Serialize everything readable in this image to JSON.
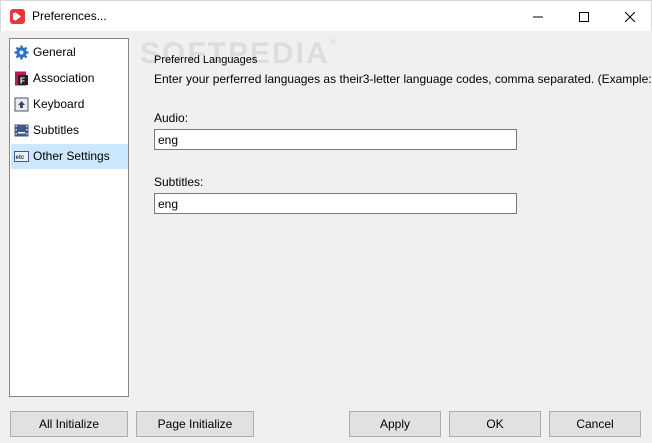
{
  "window": {
    "title": "Preferences...",
    "app_icon": "app-logo-icon",
    "controls": {
      "minimize": "minimize-icon",
      "maximize": "maximize-icon",
      "close": "close-icon"
    }
  },
  "watermark": {
    "text": "SOFTPEDIA",
    "mark": "®"
  },
  "sidebar": {
    "items": [
      {
        "label": "General",
        "icon": "gear-icon"
      },
      {
        "label": "Association",
        "icon": "file-association-icon"
      },
      {
        "label": "Keyboard",
        "icon": "keyboard-icon"
      },
      {
        "label": "Subtitles",
        "icon": "subtitles-icon"
      },
      {
        "label": "Other Settings",
        "icon": "etc-icon",
        "selected": true
      }
    ]
  },
  "content": {
    "section_title": "Preferred Languages",
    "description": "Enter your perferred languages as their3-letter language codes, comma separated. (Example: \"eng,g",
    "audio": {
      "label": "Audio:",
      "value": "eng"
    },
    "subtitles": {
      "label": "Subtitles:",
      "value": "eng"
    }
  },
  "buttons": {
    "all_initialize": "All Initialize",
    "page_initialize": "Page Initialize",
    "apply": "Apply",
    "ok": "OK",
    "cancel": "Cancel"
  },
  "colors": {
    "selection": "#cce8ff",
    "app_icon_red": "#e8373a",
    "button_face": "#e1e1e1"
  }
}
